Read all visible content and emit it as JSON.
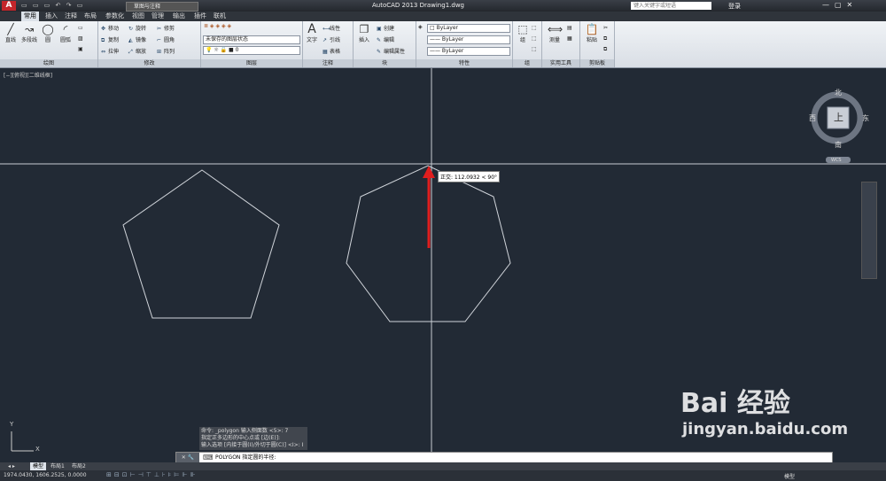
{
  "app": {
    "title": "AutoCAD 2013    Drawing1.dwg",
    "workspace": "草图与注释",
    "search_placeholder": "键入关键字或短语",
    "login": "登录"
  },
  "ribbon_tabs": [
    "常用",
    "插入",
    "注释",
    "布局",
    "参数化",
    "视图",
    "管理",
    "输出",
    "插件",
    "联机"
  ],
  "panels": {
    "draw": {
      "title": "绘图",
      "line": "直线",
      "polyline": "多段线",
      "circle": "圆",
      "arc": "圆弧"
    },
    "modify": {
      "title": "修改",
      "move": "移动",
      "rotate": "旋转",
      "trim": "修剪",
      "copy": "复制",
      "mirror": "镜像",
      "fillet": "圆角",
      "stretch": "拉伸",
      "scale": "缩放",
      "array": "阵列"
    },
    "layers": {
      "title": "图层",
      "state": "未保存的图层状态",
      "current": "0"
    },
    "annotation": {
      "title": "注释",
      "text": "文字",
      "linear": "线性",
      "leader": "引线",
      "table": "表格"
    },
    "block": {
      "title": "块",
      "insert": "插入",
      "create": "创建",
      "edit": "编辑",
      "edit_attr": "编辑属性"
    },
    "properties": {
      "title": "特性",
      "color": "ByLayer",
      "linetype": "ByLayer",
      "lineweight": "ByLayer"
    },
    "groups": {
      "title": "组",
      "group": "组"
    },
    "utilities": {
      "title": "实用工具",
      "measure": "测量"
    },
    "clipboard": {
      "title": "剪贴板",
      "paste": "粘贴"
    }
  },
  "viewport_label": "[−][俯视][二维线框]",
  "viewcube": {
    "north": "北",
    "south": "南",
    "east": "东",
    "west": "西",
    "face": "上",
    "wcs": "WCS"
  },
  "tooltip": "正交: 112.0932 < 90°",
  "command_history": [
    "命令: _polygon 输入侧面数 <5>: 7",
    "指定正多边形的中心点或 [边(E)]:",
    "输入选项 [内接于圆(I)/外切于圆(C)] <I>: I"
  ],
  "command_line": "POLYGON 指定圆的半径:",
  "layout_tabs": [
    "模型",
    "布局1",
    "布局2"
  ],
  "status": {
    "coords": "1974.0430, 1606.2525, 0.0000",
    "model": "模型"
  },
  "watermark": {
    "brand": "Bai 经验",
    "url": "jingyan.baidu.com"
  }
}
